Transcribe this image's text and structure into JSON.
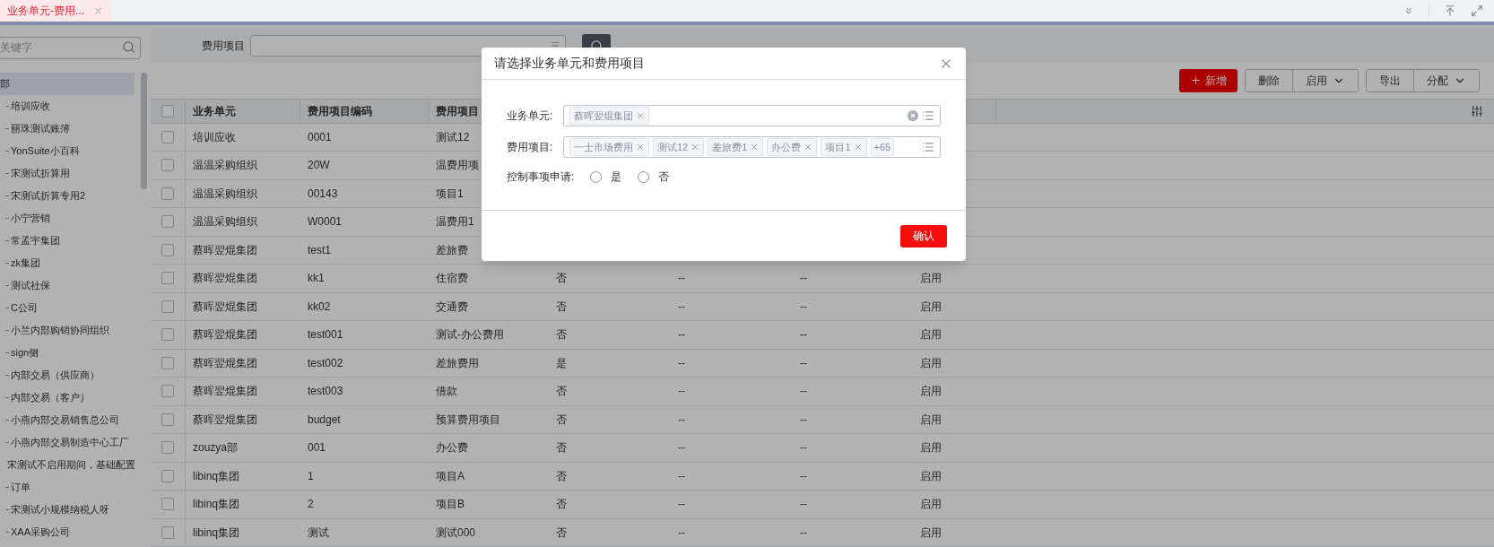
{
  "tab_bar": {
    "tabs": [
      {
        "label": "业务单元-费用...",
        "selected": true
      }
    ]
  },
  "sidebar": {
    "search": {
      "placeholder": "关键字"
    },
    "tree": [
      {
        "label": "部",
        "selected": true,
        "children": [
          {
            "label": "培训应收",
            "selected": false
          },
          {
            "label": "丽珠测试账簿",
            "selected": false
          },
          {
            "label": "YonSuite小百科",
            "selected": false
          },
          {
            "label": "宋测试折算用",
            "selected": false
          },
          {
            "label": "宋测试折算专用2",
            "selected": false
          },
          {
            "label": "小宁营销",
            "selected": false
          },
          {
            "label": "常孟宇集团",
            "selected": false
          },
          {
            "label": "zk集团",
            "selected": false
          },
          {
            "label": "测试社保",
            "selected": false
          },
          {
            "label": "C公司",
            "selected": false
          },
          {
            "label": "小兰内部购销协同组织",
            "selected": false
          },
          {
            "label": "sign侧",
            "selected": false
          },
          {
            "label": "内部交易（供应商）",
            "selected": false
          },
          {
            "label": "内部交易（客户）",
            "selected": false
          },
          {
            "label": "小燕内部交易销售总公司",
            "selected": false
          },
          {
            "label": "小燕内部交易制造中心工厂",
            "selected": false
          },
          {
            "label": "宋测试不启用期间，基础配置",
            "selected": false
          },
          {
            "label": "订单",
            "selected": false
          },
          {
            "label": "宋测试小规模纳税人呀",
            "selected": false
          },
          {
            "label": "XAA采购公司",
            "selected": false
          }
        ]
      }
    ]
  },
  "filter": {
    "label": "费用项目"
  },
  "toolbar": {
    "primary": {
      "label": "新增"
    },
    "groups": [
      {
        "buttons": [
          {
            "label": "删除",
            "kind": "plain"
          },
          {
            "label": "启用",
            "kind": "dropdown"
          }
        ]
      },
      {
        "buttons": [
          {
            "label": "导出",
            "kind": "plain"
          },
          {
            "label": "分配",
            "kind": "dropdown"
          }
        ]
      }
    ]
  },
  "table": {
    "select_all": {
      "checked": false
    },
    "columns": [
      "业务单元",
      "费用项目编码",
      "费用项目"
    ],
    "rows": [
      {
        "checked": false,
        "cells": [
          "培训应收",
          "0001",
          "测试12"
        ]
      },
      {
        "checked": false,
        "cells": [
          "温温采购组织",
          "20W",
          "温费用项"
        ]
      },
      {
        "checked": false,
        "cells": [
          "温温采购组织",
          "00143",
          "项目1"
        ]
      },
      {
        "checked": false,
        "cells": [
          "温温采购组织",
          "W0001",
          "温费用1"
        ]
      },
      {
        "checked": false,
        "cells": [
          "蔡晖翌焜集团",
          "test1",
          "差旅费"
        ]
      },
      {
        "checked": false,
        "cells": [
          "蔡晖翌焜集团",
          "kk1",
          "住宿费",
          "否",
          "--",
          "--",
          "启用"
        ]
      },
      {
        "checked": false,
        "cells": [
          "蔡晖翌焜集团",
          "kk02",
          "交通费",
          "否",
          "--",
          "--",
          "启用"
        ]
      },
      {
        "checked": false,
        "cells": [
          "蔡晖翌焜集团",
          "test001",
          "测试-办公费用",
          "否",
          "--",
          "--",
          "启用"
        ]
      },
      {
        "checked": false,
        "cells": [
          "蔡晖翌焜集团",
          "test002",
          "差旅费用",
          "是",
          "--",
          "--",
          "启用"
        ]
      },
      {
        "checked": false,
        "cells": [
          "蔡晖翌焜集团",
          "test003",
          "借款",
          "否",
          "--",
          "--",
          "启用"
        ]
      },
      {
        "checked": false,
        "cells": [
          "蔡晖翌焜集团",
          "budget",
          "预算费用项目",
          "否",
          "--",
          "--",
          "启用"
        ]
      },
      {
        "checked": false,
        "cells": [
          "zouzya部",
          "001",
          "办公费",
          "否",
          "--",
          "--",
          "启用"
        ]
      },
      {
        "checked": false,
        "cells": [
          "libinq集团",
          "1",
          "项目A",
          "否",
          "--",
          "--",
          "启用"
        ]
      },
      {
        "checked": false,
        "cells": [
          "libinq集团",
          "2",
          "项目B",
          "否",
          "--",
          "--",
          "启用"
        ]
      },
      {
        "checked": false,
        "cells": [
          "libinq集团",
          "测试",
          "测试000",
          "否",
          "--",
          "--",
          "启用"
        ]
      }
    ]
  },
  "dialog": {
    "title": "请选择业务单元和费用项目",
    "fields": [
      {
        "label": "业务单元:",
        "kind": "tags",
        "tags": [
          "蔡晖翌焜集团"
        ],
        "clearable": true
      },
      {
        "label": "费用项目:",
        "kind": "tags",
        "tags": [
          "一士市场费用",
          "测试12",
          "差旅费1",
          "办公费",
          "项目1"
        ],
        "more": "+65",
        "clearable": false
      },
      {
        "label": "控制事项申请:",
        "kind": "radio",
        "options": [
          {
            "label": "是",
            "selected": false
          },
          {
            "label": "否",
            "selected": false
          }
        ]
      }
    ],
    "confirm": "确认"
  }
}
